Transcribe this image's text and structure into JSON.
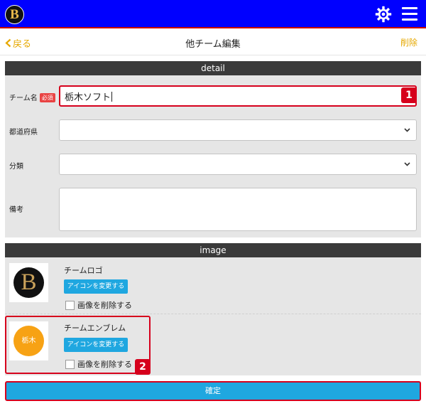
{
  "header": {
    "logo_letter": "B",
    "settings_icon": "gear-icon",
    "menu_icon": "hamburger-menu-icon",
    "accent_color": "#0000ff"
  },
  "navbar": {
    "back_label": "戻る",
    "title": "他チーム編集",
    "delete_label": "削除",
    "link_color": "#e6a800"
  },
  "detail": {
    "section_title": "detail",
    "team_name_label": "チーム名",
    "required_badge": "必須",
    "team_name_value": "栃木ソフト",
    "prefecture_label": "都道府県",
    "prefecture_value": "",
    "category_label": "分類",
    "category_value": "",
    "notes_label": "備考",
    "notes_value": "",
    "marker_1": "1"
  },
  "image": {
    "section_title": "image",
    "logo": {
      "title": "チームロゴ",
      "logo_letter": "B",
      "change_button": "アイコンを変更する",
      "delete_checkbox_label": "画像を削除する",
      "delete_checked": false
    },
    "emblem": {
      "title": "チームエンブレム",
      "emblem_text": "栃木",
      "change_button": "アイコンを変更する",
      "delete_checkbox_label": "画像を削除する",
      "delete_checked": false,
      "emblem_color": "#f7a214"
    },
    "marker_2": "2"
  },
  "footer": {
    "confirm_label": "確定",
    "confirm_color": "#1fa7e0"
  }
}
